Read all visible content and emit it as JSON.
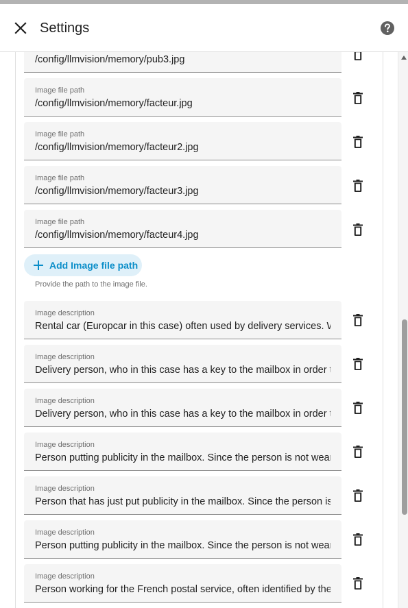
{
  "header": {
    "title": "Settings",
    "close_icon": "close-icon",
    "help_icon": "help-circle-icon"
  },
  "image_paths": {
    "label": "Image file path",
    "items": [
      {
        "label": "",
        "value": "/config/llmvision/memory/pub3.jpg"
      },
      {
        "label": "Image file path",
        "value": "/config/llmvision/memory/facteur.jpg"
      },
      {
        "label": "Image file path",
        "value": "/config/llmvision/memory/facteur2.jpg"
      },
      {
        "label": "Image file path",
        "value": "/config/llmvision/memory/facteur3.jpg"
      },
      {
        "label": "Image file path",
        "value": "/config/llmvision/memory/facteur4.jpg"
      }
    ],
    "add_label": "Add Image file path",
    "helper": "Provide the path to the image file."
  },
  "image_descriptions": {
    "items": [
      {
        "label": "Image description",
        "value": "Rental car (Europcar in this case) often used by delivery services. We"
      },
      {
        "label": "Image description",
        "value": "Delivery person, who in this case has a key to the mailbox in order to"
      },
      {
        "label": "Image description",
        "value": "Delivery person, who in this case has a key to the mailbox in order to"
      },
      {
        "label": "Image description",
        "value": "Person putting publicity in the mailbox. Since the person is not weari"
      },
      {
        "label": "Image description",
        "value": "Person that has just put publicity in the mailbox. Since the person is"
      },
      {
        "label": "Image description",
        "value": "Person putting publicity in the mailbox. Since the person is not weari"
      },
      {
        "label": "Image description",
        "value": "Person working for the French postal service, often identified by the"
      }
    ]
  },
  "colors": {
    "accent": "#0b8ec9",
    "accent_bg": "#dff0f9",
    "field_bg": "#f5f5f5"
  }
}
